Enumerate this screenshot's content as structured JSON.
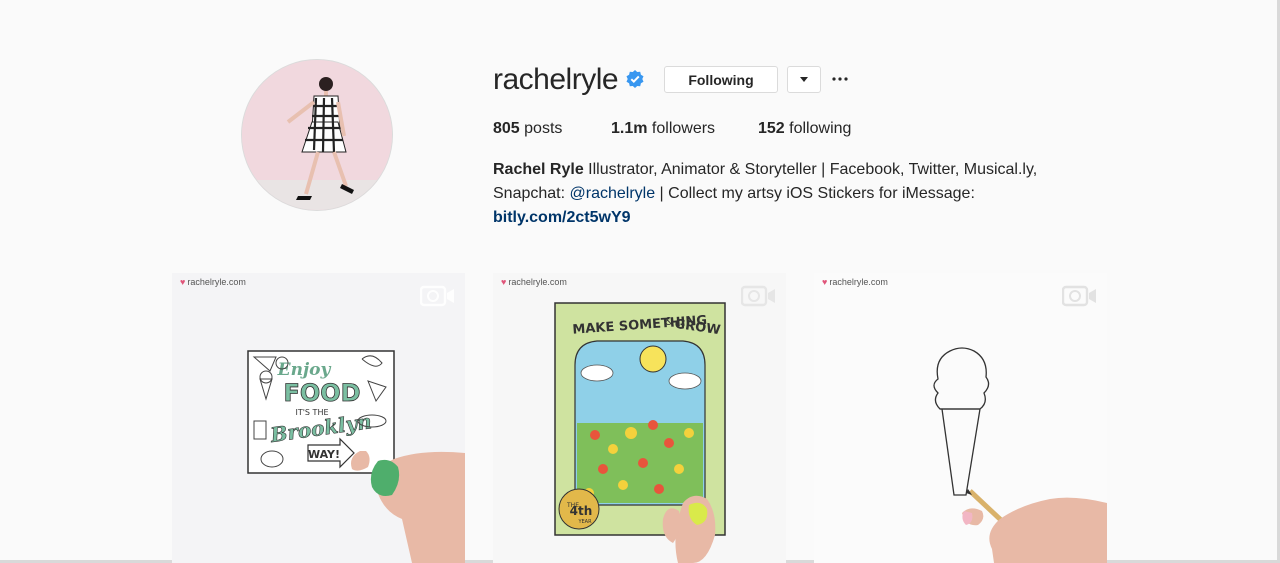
{
  "profile": {
    "username": "rachelryle",
    "verified": true,
    "following_label": "Following",
    "dropdown_icon": "caret-down-icon",
    "more_icon": "more-horizontal-icon"
  },
  "stats": {
    "posts_count": "805",
    "posts_label": "posts",
    "followers_count": "1.1m",
    "followers_label": "followers",
    "following_count": "152",
    "following_label": "following"
  },
  "bio": {
    "name": "Rachel Ryle",
    "line1_text": " Illustrator, Animator & Storyteller | Facebook, Twitter, Musical.ly,",
    "line2_prefix": "Snapchat: ",
    "mention": "@rachelryle",
    "line2_suffix": " | Collect my artsy iOS Stickers for iMessage:",
    "link": "bitly.com/2ct5wY9"
  },
  "posts": [
    {
      "watermark": "rachelryle.com",
      "type": "video",
      "card_text": [
        "Enjoy",
        "FOOD",
        "IT'S THE",
        "Brooklyn",
        "WAY!"
      ]
    },
    {
      "watermark": "rachelryle.com",
      "type": "video",
      "card_text": [
        "MAKE SOMETHING",
        "&",
        "GROW",
        "THE",
        "4th",
        "YEAR"
      ]
    },
    {
      "watermark": "rachelryle.com",
      "type": "video"
    }
  ],
  "colors": {
    "background": "#fafafa",
    "text": "#262626",
    "link": "#003569",
    "verified_badge": "#3897f0",
    "border": "#dbdbdb"
  }
}
